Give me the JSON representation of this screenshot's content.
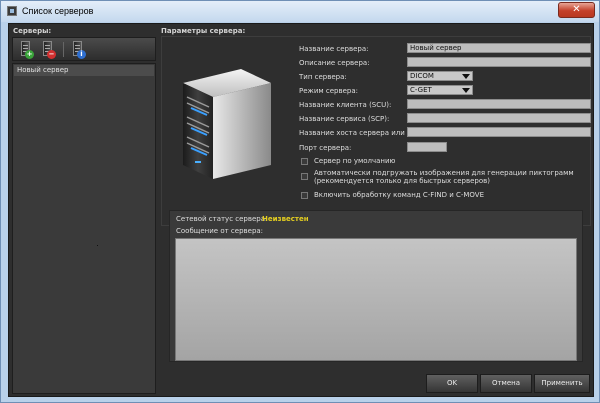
{
  "window": {
    "title": "Список серверов",
    "close_glyph": "✕"
  },
  "left_panel": {
    "title": "Серверы:",
    "toolbar": [
      {
        "name": "add-server-button",
        "icon": "server-add-icon",
        "badge": "+",
        "badge_color": "#3aa43a"
      },
      {
        "name": "remove-server-button",
        "icon": "server-remove-icon",
        "badge": "−",
        "badge_color": "#d03030"
      },
      {
        "name": "server-info-button",
        "icon": "server-info-icon",
        "badge": "i",
        "badge_color": "#2f6fd0"
      }
    ],
    "servers": [
      "Новый сервер"
    ]
  },
  "params": {
    "title": "Параметры сервера:",
    "server_name_label": "Название сервера:",
    "server_name_value": "Новый сервер",
    "description_label": "Описание сервера:",
    "description_value": "",
    "type_label": "Тип сервера:",
    "type_value": "DICOM",
    "mode_label": "Режим сервера:",
    "mode_value": "C-GET",
    "client_name_label": "Название клиента (SCU):",
    "client_name_value": "",
    "service_name_label": "Название сервиса (SCP):",
    "service_name_value": "",
    "host_label": "Название хоста сервера или IP:",
    "host_value": "",
    "port_label": "Порт сервера:",
    "port_value": "",
    "default_server_label": "Сервер по умолчанию",
    "auto_load_label_1": "Автоматически подгружать изображения для генерации пиктограмм",
    "auto_load_label_2": "(рекомендуется только для быстрых серверов)",
    "cfind_label": "Включить обработку команд C-FIND и C-MOVE"
  },
  "status": {
    "network_label": "Сетевой статус сервера:",
    "network_value": "Неизвестен",
    "network_value_color": "#e5cf20",
    "message_label": "Сообщение от сервера:",
    "message_value": ""
  },
  "buttons": {
    "ok": "OK",
    "cancel": "Отмена",
    "apply": "Применить"
  }
}
